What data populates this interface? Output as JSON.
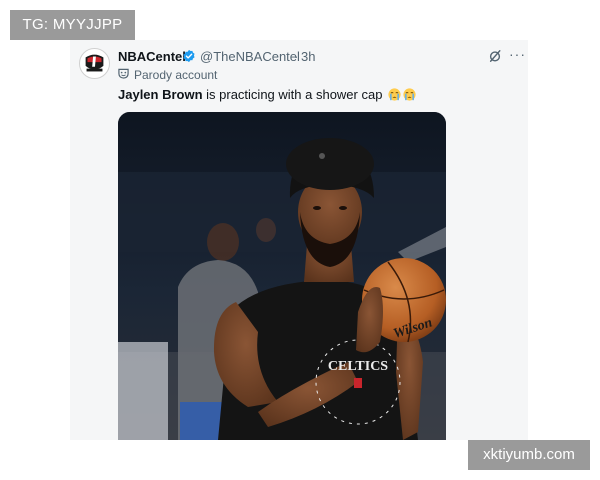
{
  "watermarks": {
    "top_left": "TG: MYYJJPP",
    "bottom_right": "xktiyumb.com"
  },
  "tweet": {
    "account_name": "NBACentel",
    "handle": "@TheNBACentel",
    "separator": "·",
    "time": "3h",
    "label": "Parody account",
    "text_bold": "Jaylen Brown",
    "text_rest": " is practicing with a shower cap",
    "emoji_count": 2
  },
  "photo": {
    "jersey_text": "CELTICS",
    "ball_brand": "Wilson"
  },
  "icons": {
    "verified": "verified-badge-icon",
    "grok": "grok-icon",
    "more": "more-icon",
    "parody": "parody-mask-icon",
    "emoji": "loudly-crying-face-emoji"
  },
  "colors": {
    "verified_blue": "#1d9bf0",
    "text_primary": "#0f1419",
    "text_secondary": "#536471",
    "watermark_bg": "#9a9a9a"
  }
}
